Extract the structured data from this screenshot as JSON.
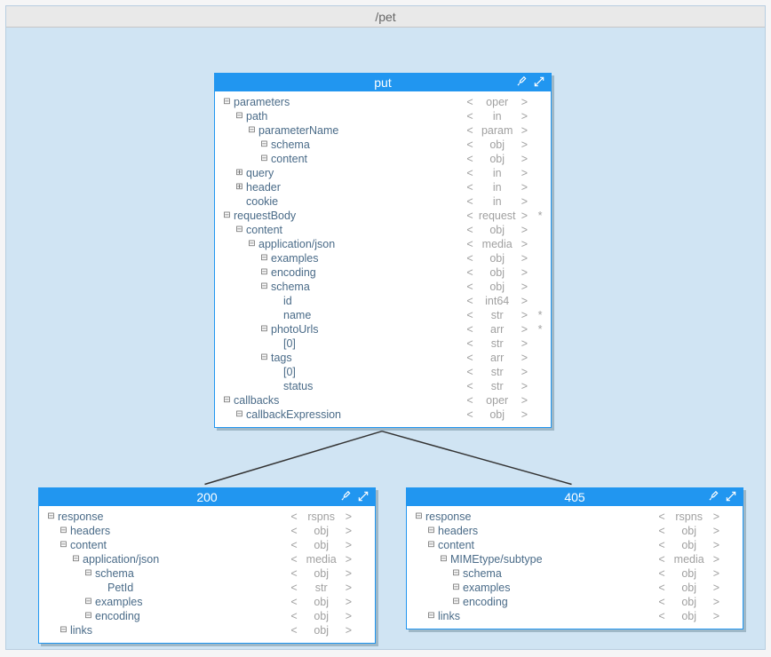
{
  "panel": {
    "title": "/pet"
  },
  "nodes": {
    "put": {
      "title": "put",
      "rows": [
        {
          "indent": 0,
          "toggle": "expanded",
          "label": "parameters",
          "type": "oper",
          "req": ""
        },
        {
          "indent": 1,
          "toggle": "expanded",
          "label": "path",
          "type": "in",
          "req": ""
        },
        {
          "indent": 2,
          "toggle": "expanded",
          "label": "parameterName",
          "type": "param",
          "req": ""
        },
        {
          "indent": 3,
          "toggle": "expanded",
          "label": "schema",
          "type": "obj",
          "req": ""
        },
        {
          "indent": 3,
          "toggle": "expanded",
          "label": "content",
          "type": "obj",
          "req": ""
        },
        {
          "indent": 1,
          "toggle": "collapsed",
          "label": "query",
          "type": "in",
          "req": ""
        },
        {
          "indent": 1,
          "toggle": "collapsed",
          "label": "header",
          "type": "in",
          "req": ""
        },
        {
          "indent": 1,
          "toggle": "none",
          "label": "cookie",
          "type": "in",
          "req": ""
        },
        {
          "indent": 0,
          "toggle": "expanded",
          "label": "requestBody",
          "type": "request",
          "req": "*"
        },
        {
          "indent": 1,
          "toggle": "expanded",
          "label": "content",
          "type": "obj",
          "req": ""
        },
        {
          "indent": 2,
          "toggle": "expanded",
          "label": "application/json",
          "type": "media",
          "req": ""
        },
        {
          "indent": 3,
          "toggle": "expanded",
          "label": "examples",
          "type": "obj",
          "req": ""
        },
        {
          "indent": 3,
          "toggle": "expanded",
          "label": "encoding",
          "type": "obj",
          "req": ""
        },
        {
          "indent": 3,
          "toggle": "expanded",
          "label": "schema",
          "type": "obj",
          "req": ""
        },
        {
          "indent": 4,
          "toggle": "none",
          "label": "id",
          "type": "int64",
          "req": ""
        },
        {
          "indent": 4,
          "toggle": "none",
          "label": "name",
          "type": "str",
          "req": "*"
        },
        {
          "indent": 3,
          "toggle": "expanded",
          "label": "photoUrls",
          "type": "arr",
          "req": "*"
        },
        {
          "indent": 4,
          "toggle": "none",
          "label": "[0]",
          "type": "str",
          "req": ""
        },
        {
          "indent": 3,
          "toggle": "expanded",
          "label": "tags",
          "type": "arr",
          "req": ""
        },
        {
          "indent": 4,
          "toggle": "none",
          "label": "[0]",
          "type": "str",
          "req": ""
        },
        {
          "indent": 4,
          "toggle": "none",
          "label": "status",
          "type": "str",
          "req": ""
        },
        {
          "indent": 0,
          "toggle": "expanded",
          "label": "callbacks",
          "type": "oper",
          "req": ""
        },
        {
          "indent": 1,
          "toggle": "expanded",
          "label": "callbackExpression",
          "type": "obj",
          "req": ""
        }
      ]
    },
    "r200": {
      "title": "200",
      "rows": [
        {
          "indent": 0,
          "toggle": "expanded",
          "label": "response",
          "type": "rspns",
          "req": ""
        },
        {
          "indent": 1,
          "toggle": "expanded",
          "label": "headers",
          "type": "obj",
          "req": ""
        },
        {
          "indent": 1,
          "toggle": "expanded",
          "label": "content",
          "type": "obj",
          "req": ""
        },
        {
          "indent": 2,
          "toggle": "expanded",
          "label": "application/json",
          "type": "media",
          "req": ""
        },
        {
          "indent": 3,
          "toggle": "expanded",
          "label": "schema",
          "type": "obj",
          "req": ""
        },
        {
          "indent": 4,
          "toggle": "none",
          "label": "PetId",
          "type": "str",
          "req": ""
        },
        {
          "indent": 3,
          "toggle": "expanded",
          "label": "examples",
          "type": "obj",
          "req": ""
        },
        {
          "indent": 3,
          "toggle": "expanded",
          "label": "encoding",
          "type": "obj",
          "req": ""
        },
        {
          "indent": 1,
          "toggle": "expanded",
          "label": "links",
          "type": "obj",
          "req": ""
        }
      ]
    },
    "r405": {
      "title": "405",
      "rows": [
        {
          "indent": 0,
          "toggle": "expanded",
          "label": "response",
          "type": "rspns",
          "req": ""
        },
        {
          "indent": 1,
          "toggle": "expanded",
          "label": "headers",
          "type": "obj",
          "req": ""
        },
        {
          "indent": 1,
          "toggle": "expanded",
          "label": "content",
          "type": "obj",
          "req": ""
        },
        {
          "indent": 2,
          "toggle": "expanded",
          "label": "MIMEtype/subtype",
          "type": "media",
          "req": ""
        },
        {
          "indent": 3,
          "toggle": "expanded",
          "label": "schema",
          "type": "obj",
          "req": ""
        },
        {
          "indent": 3,
          "toggle": "expanded",
          "label": "examples",
          "type": "obj",
          "req": ""
        },
        {
          "indent": 3,
          "toggle": "expanded",
          "label": "encoding",
          "type": "obj",
          "req": ""
        },
        {
          "indent": 1,
          "toggle": "expanded",
          "label": "links",
          "type": "obj",
          "req": ""
        }
      ]
    }
  },
  "chevrons": {
    "left": "<",
    "right": ">"
  }
}
